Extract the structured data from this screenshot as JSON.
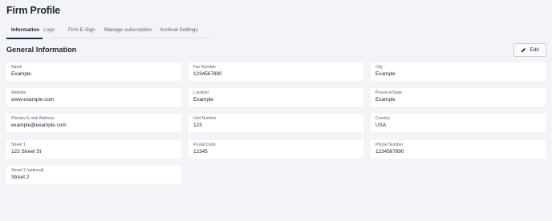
{
  "page": {
    "title": "Firm Profile"
  },
  "tabs": [
    {
      "label": "Information",
      "active": true
    },
    {
      "label": "Logo",
      "active": false
    },
    {
      "label": "Firm E-Sign",
      "active": false
    },
    {
      "label": "Manage subscription",
      "active": false
    },
    {
      "label": "Archival Settings",
      "active": false
    }
  ],
  "section": {
    "title": "General Information",
    "edit_label": "Edit",
    "edit_icon": "pencil-icon"
  },
  "fields": {
    "col1": [
      {
        "label": "Name",
        "value": "Example"
      },
      {
        "label": "Website",
        "value": "www.example.com"
      },
      {
        "label": "Primary E-mail Address",
        "value": "example@example.com"
      },
      {
        "label": "Street 1",
        "value": "123 Street St"
      },
      {
        "label": "Street 2 (optional)",
        "value": "Street 2"
      }
    ],
    "col2": [
      {
        "label": "Fax Number",
        "value": "1234567890"
      },
      {
        "label": "Location",
        "value": "Example"
      },
      {
        "label": "Unit Number",
        "value": "123"
      },
      {
        "label": "Postal Code",
        "value": "12345"
      }
    ],
    "col3": [
      {
        "label": "City",
        "value": "Example"
      },
      {
        "label": "Province/State",
        "value": "Example"
      },
      {
        "label": "Country",
        "value": "USA"
      },
      {
        "label": "Phone Number",
        "value": "1234567890"
      }
    ]
  },
  "colors": {
    "background": "#f3f4f7",
    "card": "#ffffff",
    "accent": "#1f2a44"
  }
}
